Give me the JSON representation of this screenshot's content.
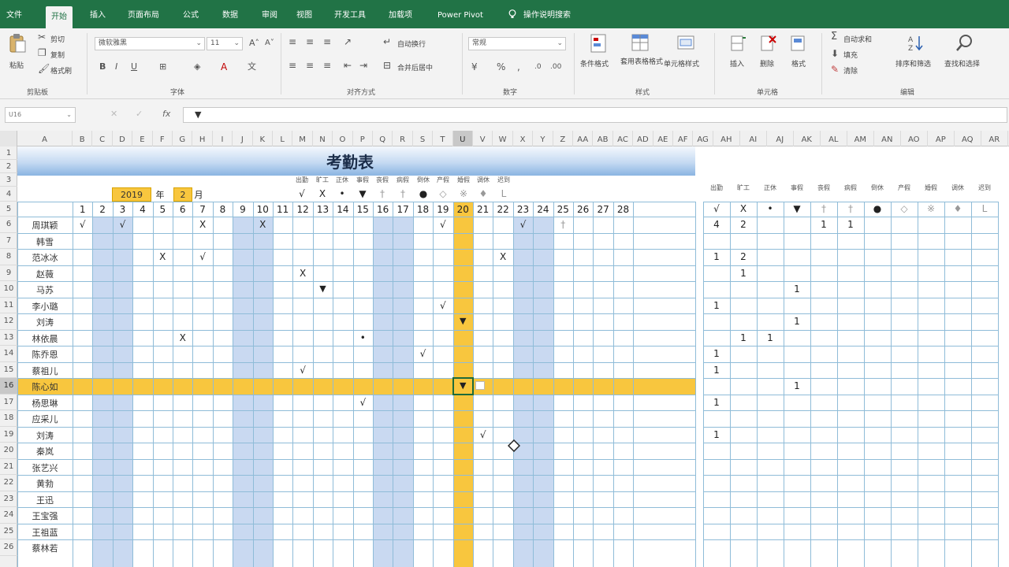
{
  "tabs": [
    "文件",
    "开始",
    "插入",
    "页面布局",
    "公式",
    "数据",
    "审阅",
    "视图",
    "开发工具",
    "加载项",
    "Power Pivot",
    "操作说明搜索"
  ],
  "active_tab": "开始",
  "ribbon": {
    "clipboard": {
      "paste": "粘贴",
      "cut": "剪切",
      "copy": "复制",
      "painter": "格式刷",
      "group": "剪贴板"
    },
    "font": {
      "name": "微软雅黑",
      "size": "11",
      "group": "字体"
    },
    "alignment": {
      "wrap": "自动换行",
      "merge": "合并后居中",
      "group": "对齐方式"
    },
    "number": {
      "format": "常规",
      "percent": "%",
      "comma": ",",
      "group": "数字"
    },
    "styles": {
      "conditional": "条件格式",
      "table": "套用表格格式",
      "cell": "单元格样式",
      "group": "样式"
    },
    "cells": {
      "insert": "插入",
      "delete": "删除",
      "format": "格式",
      "group": "单元格"
    },
    "editing": {
      "autosum": "自动求和",
      "fill": "填充",
      "clear": "清除",
      "sort": "排序和筛选",
      "find": "查找和选择",
      "group": "编辑"
    }
  },
  "formula_bar": {
    "name_box": "U16",
    "fx": "fx",
    "content": "▼"
  },
  "columns": [
    "A",
    "B",
    "C",
    "D",
    "E",
    "F",
    "G",
    "H",
    "I",
    "J",
    "K",
    "L",
    "M",
    "N",
    "O",
    "P",
    "Q",
    "R",
    "S",
    "T",
    "U",
    "V",
    "W",
    "X",
    "Y",
    "Z",
    "AA",
    "AB",
    "AC",
    "AD",
    "AE",
    "AF",
    "AG",
    "AH",
    "AI",
    "AJ",
    "AK",
    "AL",
    "AM",
    "AN",
    "AO",
    "AP",
    "AQ",
    "AR"
  ],
  "selected_column": "U",
  "rows": [
    "1",
    "2",
    "3",
    "4",
    "5",
    "6",
    "7",
    "8",
    "9",
    "10",
    "11",
    "12",
    "13",
    "14",
    "15",
    "16",
    "17",
    "18",
    "19",
    "20",
    "21",
    "22",
    "23",
    "24",
    "25",
    "26"
  ],
  "selected_row": "16",
  "sheet": {
    "title": "考勤表",
    "year": "2019",
    "year_label": "年",
    "month": "2",
    "month_label": "月",
    "legend_labels": [
      "出勤",
      "旷工",
      "正休",
      "事假",
      "丧假",
      "病假",
      "倒休",
      "产假",
      "婚假",
      "调休",
      "迟到"
    ],
    "legend_symbols": [
      "√",
      "X",
      "•",
      "▼",
      "†",
      "†",
      "●",
      "◇",
      "※",
      "♦",
      "L"
    ],
    "days": [
      "1",
      "2",
      "3",
      "4",
      "5",
      "6",
      "7",
      "8",
      "9",
      "10",
      "11",
      "12",
      "13",
      "14",
      "15",
      "16",
      "17",
      "18",
      "19",
      "20",
      "21",
      "22",
      "23",
      "24",
      "25",
      "26",
      "27",
      "28"
    ],
    "names": [
      "周琪颖",
      "韩雪",
      "范冰冰",
      "赵薇",
      "马苏",
      "李小璐",
      "刘涛",
      "林依晨",
      "陈乔恩",
      "蔡祖儿",
      "陈心如",
      "杨思琳",
      "应采儿",
      "刘涛",
      "秦岚",
      "张艺兴",
      "黄勃",
      "王迅",
      "王宝强",
      "王祖蓝",
      "蔡林若"
    ],
    "marks": [
      {
        "row": 6,
        "day": 1,
        "v": "√"
      },
      {
        "row": 6,
        "day": 3,
        "v": "√"
      },
      {
        "row": 6,
        "day": 7,
        "v": "X"
      },
      {
        "row": 6,
        "day": 10,
        "v": "X"
      },
      {
        "row": 6,
        "day": 19,
        "v": "√"
      },
      {
        "row": 6,
        "day": 23,
        "v": "√"
      },
      {
        "row": 6,
        "day": 25,
        "v": "†"
      },
      {
        "row": 8,
        "day": 5,
        "v": "X"
      },
      {
        "row": 8,
        "day": 7,
        "v": "√"
      },
      {
        "row": 8,
        "day": 22,
        "v": "X"
      },
      {
        "row": 9,
        "day": 12,
        "v": "X"
      },
      {
        "row": 10,
        "day": 13,
        "v": "▼"
      },
      {
        "row": 11,
        "day": 19,
        "v": "√"
      },
      {
        "row": 12,
        "day": 20,
        "v": "▼"
      },
      {
        "row": 13,
        "day": 6,
        "v": "X"
      },
      {
        "row": 13,
        "day": 15,
        "v": "•"
      },
      {
        "row": 14,
        "day": 18,
        "v": "√"
      },
      {
        "row": 15,
        "day": 12,
        "v": "√"
      },
      {
        "row": 16,
        "day": 20,
        "v": "▼"
      },
      {
        "row": 17,
        "day": 15,
        "v": "√"
      },
      {
        "row": 19,
        "day": 21,
        "v": "√"
      }
    ],
    "weekend_days": [
      2,
      3,
      9,
      10,
      16,
      17,
      23,
      24
    ],
    "highlight_day": 20,
    "highlight_row": 16,
    "summary_headers": [
      "出勤",
      "旷工",
      "正休",
      "事假",
      "丧假",
      "病假",
      "倒休",
      "产假",
      "婚假",
      "调休",
      "迟到"
    ],
    "summary_symbols": [
      "√",
      "X",
      "•",
      "▼",
      "†",
      "†",
      "●",
      "◇",
      "※",
      "♦",
      "L"
    ],
    "summary": [
      {
        "row": 6,
        "col": 0,
        "v": "4"
      },
      {
        "row": 6,
        "col": 1,
        "v": "2"
      },
      {
        "row": 6,
        "col": 4,
        "v": "1"
      },
      {
        "row": 6,
        "col": 5,
        "v": "1"
      },
      {
        "row": 8,
        "col": 0,
        "v": "1"
      },
      {
        "row": 8,
        "col": 1,
        "v": "2"
      },
      {
        "row": 9,
        "col": 1,
        "v": "1"
      },
      {
        "row": 10,
        "col": 3,
        "v": "1"
      },
      {
        "row": 11,
        "col": 0,
        "v": "1"
      },
      {
        "row": 12,
        "col": 3,
        "v": "1"
      },
      {
        "row": 13,
        "col": 1,
        "v": "1"
      },
      {
        "row": 13,
        "col": 2,
        "v": "1"
      },
      {
        "row": 14,
        "col": 0,
        "v": "1"
      },
      {
        "row": 15,
        "col": 0,
        "v": "1"
      },
      {
        "row": 16,
        "col": 3,
        "v": "1"
      },
      {
        "row": 17,
        "col": 0,
        "v": "1"
      },
      {
        "row": 19,
        "col": 0,
        "v": "1"
      }
    ]
  },
  "colors": {
    "excel_green": "#217346",
    "highlight": "#f8c63e",
    "weekend": "#c9d9f1",
    "grid": "#8fbcd8"
  }
}
